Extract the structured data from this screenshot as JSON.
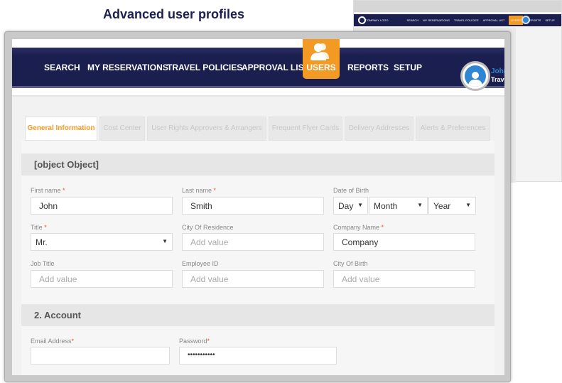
{
  "headline": "Advanced user profiles",
  "background_preview": {
    "logo_text": "COMPANY LOGO",
    "nav": [
      "SEARCH",
      "MY RESERVATIONS",
      "TRAVEL POLICIES",
      "APPROVAL LIST",
      "USERS",
      "REPORTS",
      "SETUP"
    ]
  },
  "nav": {
    "items": [
      "SEARCH",
      "MY RESERVATIONS",
      "TRAVEL POLICIES",
      "APPROVAL LIST",
      "USERS",
      "REPORTS",
      "SETUP"
    ],
    "active": "USERS",
    "user_name": "John",
    "user_role": "Travel"
  },
  "colors": {
    "navy": "#1b1f50",
    "accent": "#f39a25",
    "blue": "#2f86d3"
  },
  "tabs": [
    {
      "label": "General Information",
      "active": true
    },
    {
      "label": "Cost Center"
    },
    {
      "label": "User Rights Approvers & Arrangers"
    },
    {
      "label": "Frequent Flyer Cards"
    },
    {
      "label": "Delivery Addresses"
    },
    {
      "label": "Alerts & Preferences"
    }
  ],
  "sections": {
    "personal": {
      "title": {
        "label": "Title",
        "value": "Mr."
      },
      "first_name": {
        "label": "First name",
        "value": "John"
      },
      "last_name": {
        "label": "Last name",
        "value": "Smith"
      },
      "dob": {
        "label": "Date of Birth",
        "day": "Day",
        "month": "Month",
        "year": "Year"
      },
      "city_residence": {
        "label": "City Of Residence",
        "placeholder": "Add value"
      },
      "company": {
        "label": "Company Name",
        "value": "Company"
      },
      "job_title": {
        "label": "Job Title",
        "placeholder": "Add value"
      },
      "employee_id": {
        "label": "Employee ID",
        "placeholder": "Add value"
      },
      "city_birth": {
        "label": "City Of Birth",
        "placeholder": "Add value"
      }
    },
    "account": {
      "title": "2. Account",
      "email": {
        "label": "Email Address",
        "value": ""
      },
      "password": {
        "label": "Password",
        "value": "•••••••••••"
      }
    }
  },
  "required_mark": "*"
}
